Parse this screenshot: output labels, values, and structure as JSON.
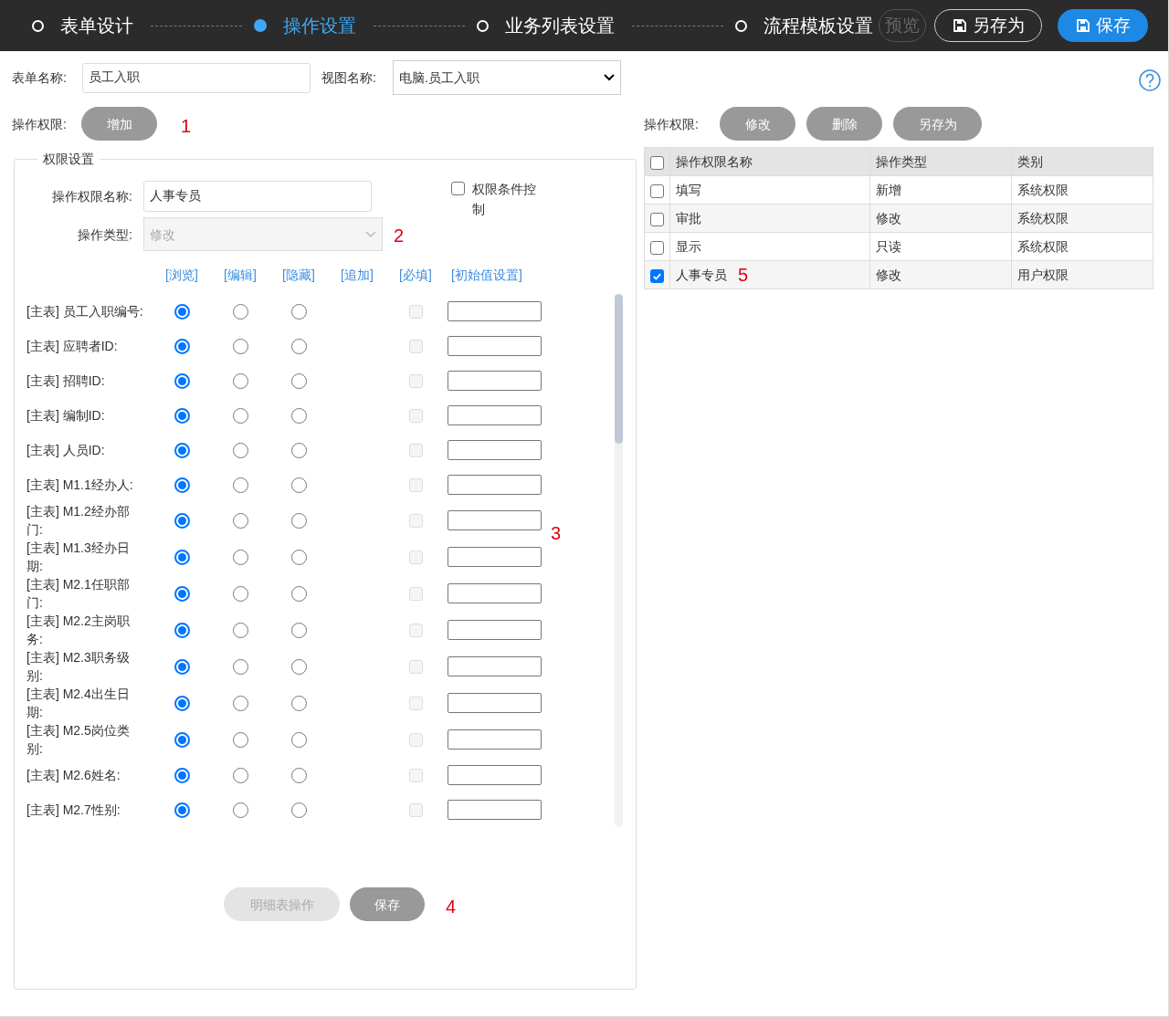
{
  "steps": [
    {
      "label": "表单设计",
      "selected": false
    },
    {
      "label": "操作设置",
      "selected": true
    },
    {
      "label": "业务列表设置",
      "selected": false
    },
    {
      "label": "流程模板设置",
      "selected": false
    }
  ],
  "toolbar": {
    "preview": "预览",
    "save_as": "另存为",
    "save": "保存"
  },
  "form": {
    "form_name_label": "表单名称:",
    "form_name": "员工入职",
    "view_label": "视图名称:",
    "view_name": "电脑.员工入职",
    "permission_label": "操作权限:",
    "add_button": "增加",
    "marker": "1"
  },
  "settings": {
    "legend": "权限设置",
    "name_label": "操作权限名称:",
    "name": "人事专员",
    "type_label": "操作类型:",
    "type_value": "修改",
    "type_disabled": true,
    "condition_label": "权限条件控制",
    "condition_checked": false,
    "marker": "2",
    "columns": [
      "[浏览]",
      "[编辑]",
      "[隐藏]",
      "[追加]",
      "[必填]",
      "[初始值设置]"
    ],
    "fields": [
      {
        "label": "[主表] 员工入职编号:",
        "options": [
          {
            "selected": true
          },
          {
            "selected": false
          },
          {
            "selected": false
          }
        ],
        "required": false
      },
      {
        "label": "[主表] 应聘者ID:",
        "options": [
          {
            "selected": true
          },
          {
            "selected": false
          },
          {
            "selected": false
          }
        ],
        "required": false
      },
      {
        "label": "[主表] 招聘ID:",
        "options": [
          {
            "selected": true
          },
          {
            "selected": false
          },
          {
            "selected": false
          }
        ],
        "required": false
      },
      {
        "label": "[主表] 编制ID:",
        "options": [
          {
            "selected": true
          },
          {
            "selected": false
          },
          {
            "selected": false
          }
        ],
        "required": false
      },
      {
        "label": "[主表] 人员ID:",
        "options": [
          {
            "selected": true
          },
          {
            "selected": false
          },
          {
            "selected": false
          }
        ],
        "required": false
      },
      {
        "label": "[主表] M1.1经办人:",
        "options": [
          {
            "selected": true
          },
          {
            "selected": false
          },
          {
            "selected": false
          }
        ],
        "required": false
      },
      {
        "label": "[主表] M1.2经办部门:",
        "options": [
          {
            "selected": true
          },
          {
            "selected": false
          },
          {
            "selected": false
          }
        ],
        "required": false,
        "marker": "3"
      },
      {
        "label": "[主表] M1.3经办日期:",
        "options": [
          {
            "selected": true
          },
          {
            "selected": false
          },
          {
            "selected": false
          }
        ],
        "required": false
      },
      {
        "label": "[主表] M2.1任职部门:",
        "options": [
          {
            "selected": true
          },
          {
            "selected": false
          },
          {
            "selected": false
          }
        ],
        "required": false
      },
      {
        "label": "[主表] M2.2主岗职务:",
        "options": [
          {
            "selected": true
          },
          {
            "selected": false
          },
          {
            "selected": false
          }
        ],
        "required": false
      },
      {
        "label": "[主表] M2.3职务级别:",
        "options": [
          {
            "selected": true
          },
          {
            "selected": false
          },
          {
            "selected": false
          }
        ],
        "required": false
      },
      {
        "label": "[主表] M2.4出生日期:",
        "options": [
          {
            "selected": true
          },
          {
            "selected": false
          },
          {
            "selected": false
          }
        ],
        "required": false
      },
      {
        "label": "[主表] M2.5岗位类别:",
        "options": [
          {
            "selected": true
          },
          {
            "selected": false
          },
          {
            "selected": false
          }
        ],
        "required": false
      },
      {
        "label": "[主表] M2.6姓名:",
        "options": [
          {
            "selected": true
          },
          {
            "selected": false
          },
          {
            "selected": false
          }
        ],
        "required": false
      },
      {
        "label": "[主表] M2.7性别:",
        "options": [
          {
            "selected": true
          },
          {
            "selected": false
          },
          {
            "selected": false
          }
        ],
        "required": false
      }
    ],
    "detail_button": "明细表操作",
    "detail_disabled": true,
    "save_button": "保存",
    "buttons_marker": "4"
  },
  "permissions": {
    "label": "操作权限:",
    "buttons": [
      "修改",
      "删除",
      "另存为"
    ],
    "columns": [
      "操作权限名称",
      "操作类型",
      "类别"
    ],
    "header_checked": false,
    "rows": [
      {
        "name": "填写",
        "type": "新增",
        "category": "系统权限",
        "checked": false
      },
      {
        "name": "审批",
        "type": "修改",
        "category": "系统权限",
        "checked": false
      },
      {
        "name": "显示",
        "type": "只读",
        "category": "系统权限",
        "checked": false
      },
      {
        "name": "人事专员",
        "marker": "5",
        "type": "修改",
        "category": "用户权限",
        "checked": true
      }
    ]
  }
}
